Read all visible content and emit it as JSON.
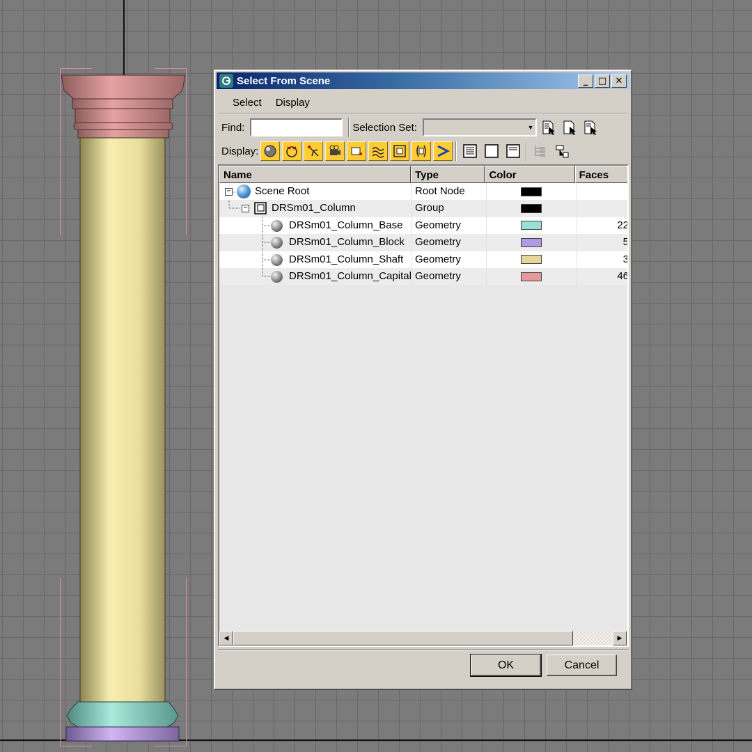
{
  "dialog": {
    "title": "Select From Scene",
    "window_buttons": {
      "minimize": "_",
      "maximize": "□",
      "close": "✕"
    },
    "menu": [
      "Select",
      "Display"
    ],
    "find": {
      "label": "Find:",
      "value": ""
    },
    "selection_set": {
      "label": "Selection Set:",
      "value": ""
    },
    "display_label": "Display:",
    "display_filters": [
      "geometry",
      "shapes",
      "lights",
      "cameras",
      "helpers",
      "space-warps",
      "groups",
      "xrefs",
      "bones"
    ],
    "columns": [
      "Name",
      "Type",
      "Color",
      "Faces"
    ],
    "rows": [
      {
        "name": "Scene Root",
        "type": "Root Node",
        "color": "#000000",
        "faces": "",
        "level": 0,
        "icon": "globe-icon"
      },
      {
        "name": "DRSm01_Column",
        "type": "Group",
        "color": "#000000",
        "faces": "",
        "level": 1,
        "icon": "group-icon"
      },
      {
        "name": "DRSm01_Column_Base",
        "type": "Geometry",
        "color": "#99e0d5",
        "faces": "22",
        "level": 2,
        "icon": "geometry-sphere-icon"
      },
      {
        "name": "DRSm01_Column_Block",
        "type": "Geometry",
        "color": "#b299e6",
        "faces": "5",
        "level": 2,
        "icon": "geometry-sphere-icon"
      },
      {
        "name": "DRSm01_Column_Shaft",
        "type": "Geometry",
        "color": "#e6d699",
        "faces": "3",
        "level": 2,
        "icon": "geometry-sphere-icon"
      },
      {
        "name": "DRSm01_Column_Capital",
        "type": "Geometry",
        "color": "#e69999",
        "faces": "46",
        "level": 2,
        "icon": "geometry-sphere-icon"
      }
    ],
    "ok_label": "OK",
    "cancel_label": "Cancel"
  },
  "viewport": {
    "model_colors": {
      "capital": "#d88e8e",
      "shaft": "#f3e8aa",
      "base": "#9ad9cc",
      "block": "#c4a8ea",
      "selection": "#e08aa8"
    }
  }
}
